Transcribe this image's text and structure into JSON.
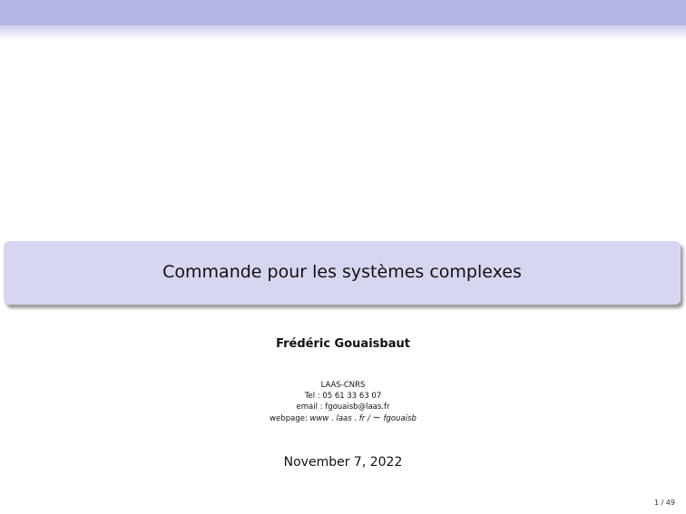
{
  "title": "Commande pour les systèmes complexes",
  "author": "Frédéric Gouaisbaut",
  "affiliation": {
    "institution": "LAAS-CNRS",
    "tel": "Tel : 05 61 33 63 07",
    "email": "email : fgouaisb@laas.fr",
    "webpage_label": "webpage:",
    "webpage_url": "www . laas . fr /",
    "webpage_tilde": "∼",
    "webpage_user": "fgouaisb"
  },
  "date": "November 7, 2022",
  "page_number": "1 / 49",
  "colors": {
    "header_band": "#b6b6e2",
    "title_box": "#d6d6f1"
  }
}
